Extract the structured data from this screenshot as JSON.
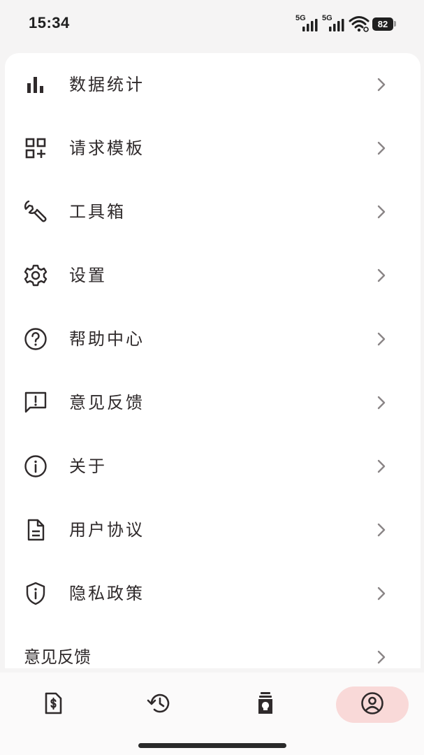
{
  "status_bar": {
    "time": "15:34",
    "signal1_label": "5G",
    "signal2_label": "5G",
    "battery": "82"
  },
  "menu": {
    "items": [
      {
        "label": "数据统计",
        "icon": "bar-chart-icon"
      },
      {
        "label": "请求模板",
        "icon": "grid-add-icon"
      },
      {
        "label": "工具箱",
        "icon": "wrench-icon"
      },
      {
        "label": "设置",
        "icon": "gear-icon"
      },
      {
        "label": "帮助中心",
        "icon": "help-circle-icon"
      },
      {
        "label": "意见反馈",
        "icon": "feedback-message-icon"
      },
      {
        "label": "关于",
        "icon": "info-circle-icon"
      },
      {
        "label": "用户协议",
        "icon": "document-icon"
      },
      {
        "label": "隐私政策",
        "icon": "shield-info-icon"
      },
      {
        "label": "意见反馈",
        "icon": ""
      }
    ]
  },
  "bottom_nav": {
    "items": [
      {
        "icon": "invoice-dollar-icon",
        "active": false
      },
      {
        "icon": "history-clock-icon",
        "active": false
      },
      {
        "icon": "lightbulb-jar-icon",
        "active": false
      },
      {
        "icon": "user-circle-icon",
        "active": true
      }
    ],
    "active_color": "#f9d9d8"
  },
  "colors": {
    "background": "#f5f4f4",
    "card": "#ffffff",
    "text": "#2f2a2b",
    "chevron": "#8a8586"
  }
}
